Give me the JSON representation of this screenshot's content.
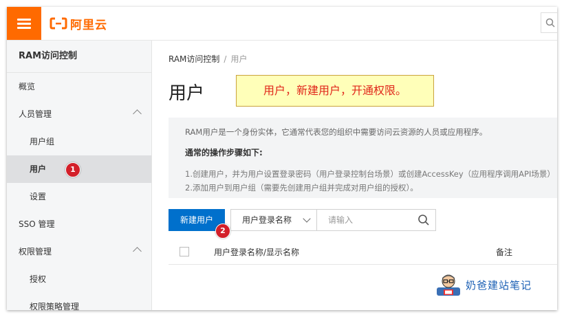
{
  "topbar": {
    "brand": "阿里云",
    "menu_icon": "hamburger-icon",
    "search_icon": "search-icon",
    "brand_color": "#ff6a00"
  },
  "sidebar": {
    "title": "RAM访问控制",
    "items": [
      {
        "label": "概览"
      },
      {
        "label": "人员管理"
      },
      {
        "label": "用户组"
      },
      {
        "label": "用户"
      },
      {
        "label": "设置"
      },
      {
        "label": "SSO 管理"
      },
      {
        "label": "权限管理"
      },
      {
        "label": "授权"
      },
      {
        "label": "权限策略管理"
      }
    ]
  },
  "annotations": {
    "badge1": "1",
    "badge2": "2",
    "callout": "用户，新建用户，开通权限。",
    "watermark": "奶爸建站笔记"
  },
  "main": {
    "breadcrumb_root": "RAM访问控制",
    "breadcrumb_sep": "/",
    "breadcrumb_current": "用户",
    "page_title": "用户",
    "info": {
      "desc": "RAM用户是一个身份实体，它通常代表您的组织中需要访问云资源的人员或应用程序。",
      "steps_title": "通常的操作步骤如下:",
      "step1": "1.创建用户，并为用户设置登录密码（用户登录控制台场景）或创建AccessKey（应用程序调用API场景）",
      "step2": "2.添加用户到用户组（需要先创建用户组并完成对用户组的授权）。"
    },
    "new_user_button": "新建用户",
    "filter_select": "用户登录名称",
    "search_placeholder": "请输入",
    "table": {
      "columns": [
        "用户登录名称/显示名称",
        "备注"
      ]
    }
  },
  "colors": {
    "primary_button": "#0070cc",
    "badge": "#d3202a",
    "callout_bg": "#ffffb9",
    "callout_text": "#e0261a"
  }
}
